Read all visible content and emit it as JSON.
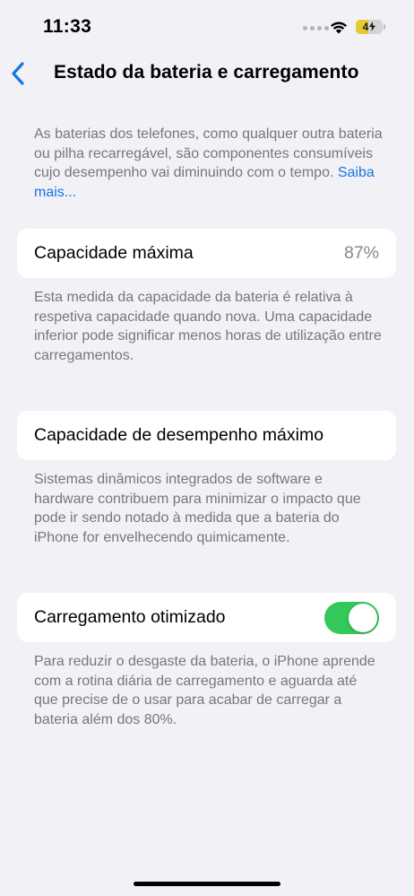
{
  "status_bar": {
    "time": "11:33",
    "battery_level": "4",
    "battery_fill_fraction": 0.45,
    "battery_fill_color": "#e6c937"
  },
  "nav": {
    "back_icon": "chevron-left-icon",
    "title": "Estado da bateria e carregamento",
    "accent_color": "#1576e2"
  },
  "intro": {
    "text": "As baterias dos telefones, como qualquer outra bateria ou pilha recarregável, são componentes consumíveis cujo desempenho vai diminuindo com o tempo.",
    "link": "Saiba mais..."
  },
  "max_capacity": {
    "label": "Capacidade máxima",
    "value": "87%",
    "description": "Esta medida da capacidade da bateria é relativa à respetiva capacidade quando nova. Uma capacidade inferior pode significar menos horas de utilização entre carregamentos."
  },
  "peak_performance": {
    "label": "Capacidade de desempenho máximo",
    "description": "Sistemas dinâmicos integrados de software e hardware contribuem para minimizar o impacto que pode ir sendo notado à medida que a bateria do iPhone for envelhecendo quimicamente."
  },
  "optimized_charging": {
    "label": "Carregamento otimizado",
    "enabled": true,
    "toggle_color": "#34c759",
    "description": "Para reduzir o desgaste da bateria, o iPhone aprende com a rotina diária de carregamento e aguarda até que precise de o usar para acabar de carregar a bateria além dos 80%."
  }
}
